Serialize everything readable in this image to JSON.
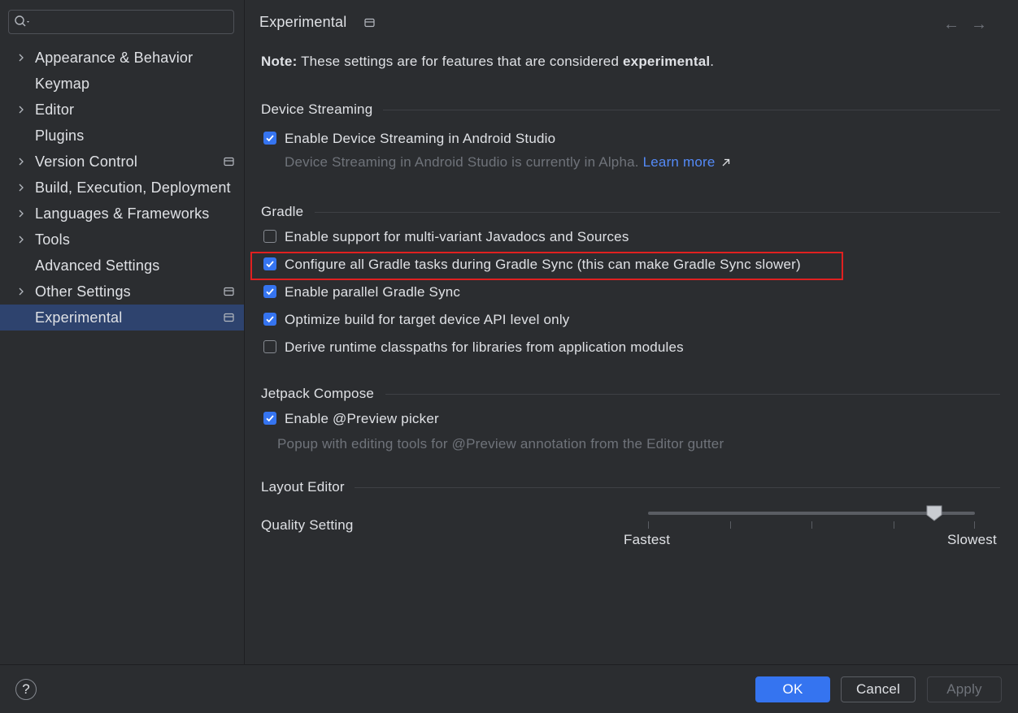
{
  "sidebar": {
    "items": [
      {
        "label": "Appearance & Behavior"
      },
      {
        "label": "Keymap"
      },
      {
        "label": "Editor"
      },
      {
        "label": "Plugins"
      },
      {
        "label": "Version Control"
      },
      {
        "label": "Build, Execution, Deployment"
      },
      {
        "label": "Languages & Frameworks"
      },
      {
        "label": "Tools"
      },
      {
        "label": "Advanced Settings"
      },
      {
        "label": "Other Settings"
      },
      {
        "label": "Experimental"
      }
    ],
    "selected": "Experimental"
  },
  "header": {
    "title": "Experimental"
  },
  "note": {
    "prefix": "Note:",
    "middle": " These settings are for features that are considered ",
    "emphasis": "experimental",
    "suffix": "."
  },
  "device_streaming": {
    "title": "Device Streaming",
    "enable_label": "Enable Device Streaming in Android Studio",
    "enable_checked": true,
    "hint": "Device Streaming in Android Studio is currently in Alpha. ",
    "learn_more": "Learn more"
  },
  "gradle": {
    "title": "Gradle",
    "options": [
      {
        "label": "Enable support for multi-variant Javadocs and Sources",
        "checked": false
      },
      {
        "label": "Configure all Gradle tasks during Gradle Sync (this can make Gradle Sync slower)",
        "checked": true
      },
      {
        "label": "Enable parallel Gradle Sync",
        "checked": true
      },
      {
        "label": "Optimize build for target device API level only",
        "checked": true
      },
      {
        "label": "Derive runtime classpaths for libraries from application modules",
        "checked": false
      }
    ]
  },
  "jetpack_compose": {
    "title": "Jetpack Compose",
    "preview_label": "Enable @Preview picker",
    "preview_checked": true,
    "hint": "Popup with editing tools for @Preview annotation from the Editor gutter"
  },
  "layout_editor": {
    "title": "Layout Editor",
    "quality_label": "Quality Setting",
    "min_label": "Fastest",
    "max_label": "Slowest",
    "quality_value": 0.875
  },
  "footer": {
    "help": "?",
    "ok": "OK",
    "cancel": "Cancel",
    "apply": "Apply"
  },
  "colors": {
    "accent": "#3574f0",
    "highlight_box": "#e02020",
    "link": "#548af7"
  }
}
